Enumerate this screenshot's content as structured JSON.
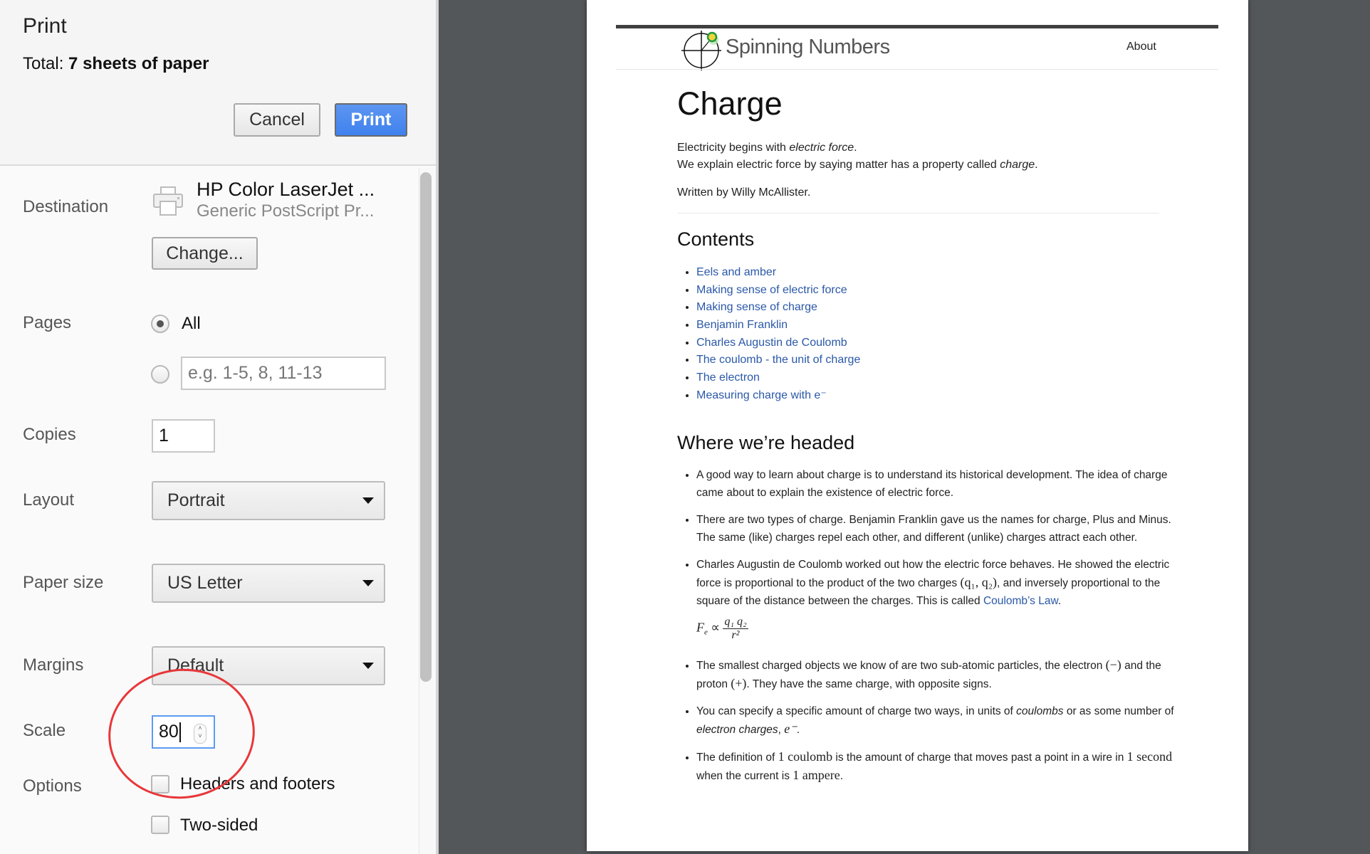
{
  "dialog": {
    "title": "Print",
    "total_label": "Total:",
    "total_value": "7 sheets of paper",
    "cancel_label": "Cancel",
    "print_label": "Print",
    "primary_color": "#4a88ef"
  },
  "settings": {
    "destination": {
      "label": "Destination",
      "icon": "printer-icon",
      "printer_name": "HP Color LaserJet ...",
      "printer_sub": "Generic PostScript Pr...",
      "change_label": "Change..."
    },
    "pages": {
      "label": "Pages",
      "all_label": "All",
      "selected": "All",
      "range_placeholder": "e.g. 1-5, 8, 11-13",
      "range_value": ""
    },
    "copies": {
      "label": "Copies",
      "value": "1"
    },
    "layout": {
      "label": "Layout",
      "value": "Portrait"
    },
    "paper_size": {
      "label": "Paper size",
      "value": "US Letter"
    },
    "margins": {
      "label": "Margins",
      "value": "Default"
    },
    "scale": {
      "label": "Scale",
      "value": "80"
    },
    "options": {
      "label": "Options",
      "items": [
        {
          "label": "Headers and footers",
          "checked": false
        },
        {
          "label": "Two-sided",
          "checked": false
        }
      ]
    }
  },
  "annotation": {
    "type": "ellipse",
    "color": "#e8373a",
    "target": "scale-input"
  },
  "preview": {
    "site_name": "Spinning Numbers",
    "nav_about": "About",
    "title": "Charge",
    "intro_1_pre": "Electricity begins with ",
    "intro_1_em": "electric force",
    "intro_1_post": ".",
    "intro_2_pre": "We explain electric force by saying matter has a property called ",
    "intro_2_em": "charge",
    "intro_2_post": ".",
    "byline": "Written by Willy McAllister.",
    "contents_heading": "Contents",
    "contents": [
      "Eels and amber",
      "Making sense of electric force",
      "Making sense of charge",
      "Benjamin Franklin",
      "Charles Augustin de Coulomb",
      "The coulomb - the unit of charge",
      "The electron",
      "Measuring charge with e⁻"
    ],
    "headed_heading": "Where we’re headed",
    "bullets": {
      "b1": "A good way to learn about charge is to understand its historical development. The idea of charge came about to explain the existence of electric force.",
      "b2": "There are two types of charge. Benjamin Franklin gave us the names for charge, Plus and Minus. The same (like) charges repel each other, and different (unlike) charges attract each other.",
      "b3_pre": "Charles Augustin de Coulomb worked out how the electric force behaves. He showed the electric force is proportional to the product of the two charges ",
      "b3_math": "(q₁, q₂)",
      "b3_mid": ", and inversely proportional to the square of the distance between the charges. This is called ",
      "b3_link": "Coulomb’s Law",
      "b3_post": ".",
      "formula_lhs": "F",
      "formula_sub": "e",
      "formula_rel": "∝",
      "formula_num": "q₁ q₂",
      "formula_den": "r²",
      "b4_pre": "The smallest charged objects we know of are two sub-atomic particles, the electron ",
      "b4_minus": "(−)",
      "b4_mid": " and the proton ",
      "b4_plus": "(+)",
      "b4_post": ". They have the same charge, with opposite signs.",
      "b5_pre": "You can specify a specific amount of charge two ways, in units of ",
      "b5_em1": "coulombs",
      "b5_mid": " or as some number of ",
      "b5_em2": "electron charges",
      "b5_sep": ", ",
      "b5_math": "e⁻",
      "b5_post": ".",
      "b6_pre": "The definition of ",
      "b6_m1": "1 coulomb",
      "b6_mid1": " is the amount of charge that moves past a point in a wire in ",
      "b6_m2": "1 second",
      "b6_mid2": " when the current is ",
      "b6_m3": "1 ampere",
      "b6_post": "."
    }
  }
}
